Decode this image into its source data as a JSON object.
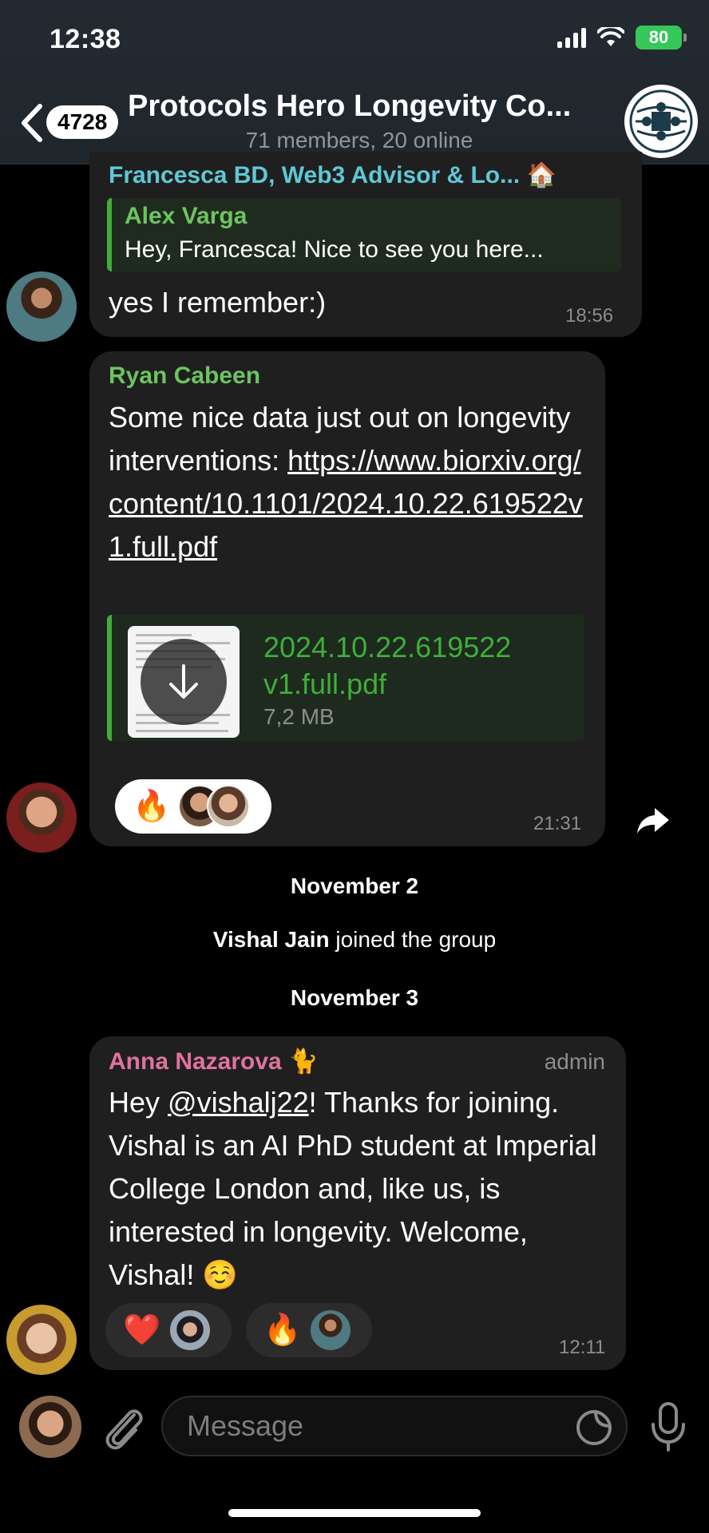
{
  "status_bar": {
    "time": "12:38",
    "battery": "80"
  },
  "header": {
    "back_count": "4728",
    "title": "Protocols Hero Longevity Co...",
    "subtitle": "71 members, 20 online"
  },
  "messages": [
    {
      "sender": "Francesca BD, Web3 Advisor & Lo...",
      "sender_emoji": "🏠",
      "sender_color": "#5fc8d6",
      "reply": {
        "author": "Alex Varga",
        "text": "Hey, Francesca! Nice to see you here..."
      },
      "text": "yes I remember:)",
      "time": "18:56"
    },
    {
      "sender": "Ryan Cabeen",
      "sender_color": "#6cc461",
      "text_prefix": "Some nice data just out on longevity interventions: ",
      "link": "https://www.biorxiv.org/content/10.1101/2024.10.22.619522v1.full.pdf",
      "file": {
        "name": "2024.10.22.619522 v1.full.pdf",
        "size": "7,2 MB"
      },
      "reaction_emoji": "🔥",
      "time": "21:31"
    },
    {
      "sender": "Anna Nazarova",
      "sender_emoji": "🐈",
      "sender_color": "#e0739e",
      "role": "admin",
      "text_hey": "Hey ",
      "mention": "@vishalj22",
      "text_rest": "! Thanks for joining. Vishal is an AI PhD student at Imperial College London and, like us, is interested in longevity. Welcome, Vishal! ☺️",
      "reactions": [
        "❤️",
        "🔥"
      ],
      "time": "12:11"
    }
  ],
  "dates": {
    "first": "November 2",
    "second": "November 3"
  },
  "service": {
    "name": "Vishal Jain",
    "action": " joined the group"
  },
  "composer": {
    "placeholder": "Message"
  }
}
